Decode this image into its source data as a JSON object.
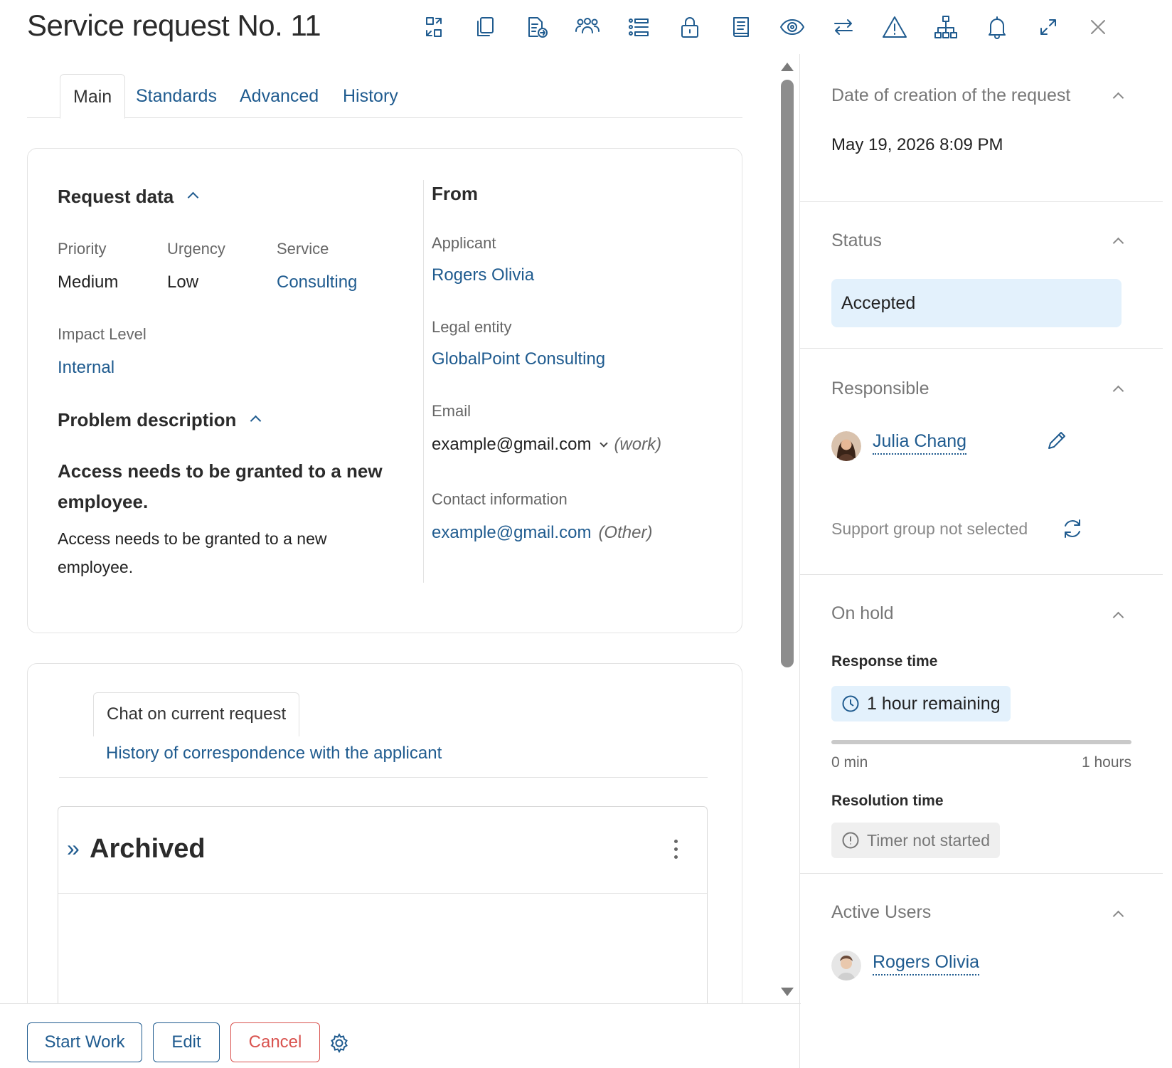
{
  "header": {
    "title": "Service request No. 11",
    "icons": [
      "convert-icon",
      "copy-icon",
      "document-send-icon",
      "users-group-icon",
      "list-icon",
      "lock-icon",
      "book-icon",
      "eye-icon",
      "transfer-icon",
      "warning-icon",
      "hierarchy-icon",
      "bell-icon",
      "expand-icon",
      "close-icon"
    ]
  },
  "tabs": [
    "Main",
    "Standards",
    "Advanced",
    "History"
  ],
  "request_data": {
    "title": "Request data",
    "priority_label": "Priority",
    "priority_value": "Medium",
    "urgency_label": "Urgency",
    "urgency_value": "Low",
    "service_label": "Service",
    "service_value": "Consulting",
    "impact_label": "Impact Level",
    "impact_value": "Internal"
  },
  "problem": {
    "title": "Problem description",
    "summary": "Access needs to be granted to a new employee.",
    "details": "Access needs to be granted to a new employee."
  },
  "from": {
    "title": "From",
    "applicant_label": "Applicant",
    "applicant_value": "Rogers Olivia",
    "legal_label": "Legal entity",
    "legal_value": "GlobalPoint Consulting",
    "email_label": "Email",
    "email_value": "example@gmail.com",
    "email_type": "(work)",
    "contact_label": "Contact information",
    "contact_value": "example@gmail.com",
    "contact_type": "(Other)"
  },
  "chat": {
    "tab_active": "Chat on current request",
    "tab_history": "History of correspondence with the applicant",
    "archived_title": "Archived"
  },
  "actions": {
    "start": "Start Work",
    "edit": "Edit",
    "cancel": "Cancel"
  },
  "side": {
    "created_title": "Date of creation of the request",
    "created_value": "May 19, 2026 8:09 PM",
    "status_title": "Status",
    "status_value": "Accepted",
    "responsible_title": "Responsible",
    "responsible_name": "Julia Chang",
    "support_group": "Support group not selected",
    "onhold_title": "On hold",
    "response_label": "Response time",
    "response_value": "1 hour remaining",
    "response_progress": 0,
    "scale_min": "0 min",
    "scale_max": "1 hours",
    "resolution_label": "Resolution time",
    "resolution_value": "Timer not started",
    "active_users_title": "Active Users",
    "active_user": "Rogers Olivia"
  },
  "colors": {
    "accent": "#1f5b8f",
    "cancel": "#d9534f",
    "status_bg": "#e3f1fc",
    "timer_bg": "#e3f1fc",
    "timer_off_bg": "#efefef"
  }
}
